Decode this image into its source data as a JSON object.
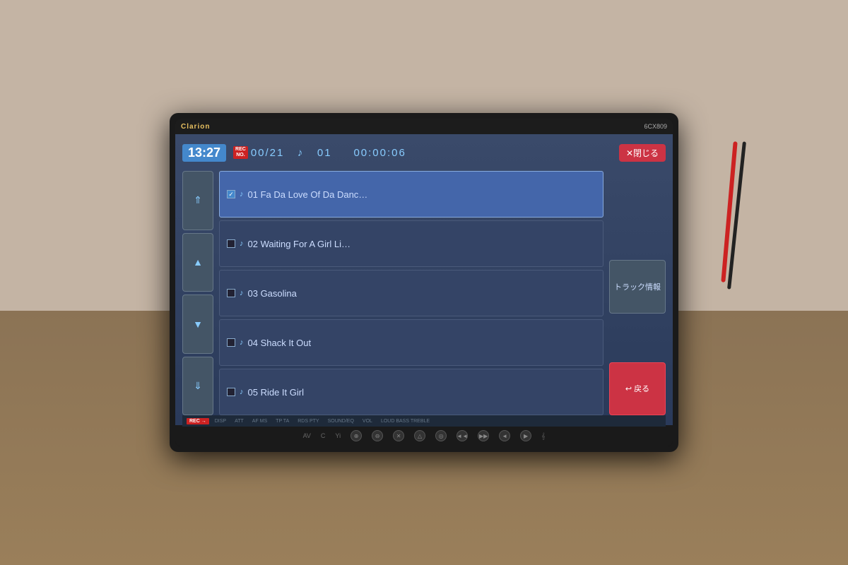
{
  "brand": "Clarion",
  "model": "6CX809",
  "time": "13:27",
  "rec_badge": "REC\nNO.",
  "track_count": "00/21",
  "music_note": "♪",
  "track_number": "01",
  "elapsed": "00:00:06",
  "close_button": "✕閉じる",
  "track_info_button": "トラック情報",
  "back_button": "↩戻る",
  "rec_indicator": "REC →",
  "tracks": [
    {
      "id": 1,
      "number": "01",
      "title": "Fa Da Love Of Da Danc…",
      "active": true,
      "checked": true
    },
    {
      "id": 2,
      "number": "02",
      "title": "Waiting For A Girl Li…",
      "active": false,
      "checked": false
    },
    {
      "id": 3,
      "number": "03",
      "title": "Gasolina",
      "active": false,
      "checked": false
    },
    {
      "id": 4,
      "number": "04",
      "title": "Shack It Out",
      "active": false,
      "checked": false
    },
    {
      "id": 5,
      "number": "05",
      "title": "Ride It Girl",
      "active": false,
      "checked": false
    }
  ],
  "nav_buttons": [
    "⇑",
    "▲",
    "▼",
    "⇓"
  ],
  "bezel_controls": [
    "AV",
    "C",
    "Yi",
    "⊕",
    "⊖",
    "⊠",
    "△",
    "◎",
    "◄◄",
    "▶▶",
    "◄",
    "▶",
    "𝄞"
  ],
  "bottom_labels": [
    "DISP",
    "ATT",
    "AF MS",
    "TP TA",
    "RDS PTY",
    "SOUND/EQ",
    "VOL",
    "LOUD BASS TREBLE"
  ]
}
